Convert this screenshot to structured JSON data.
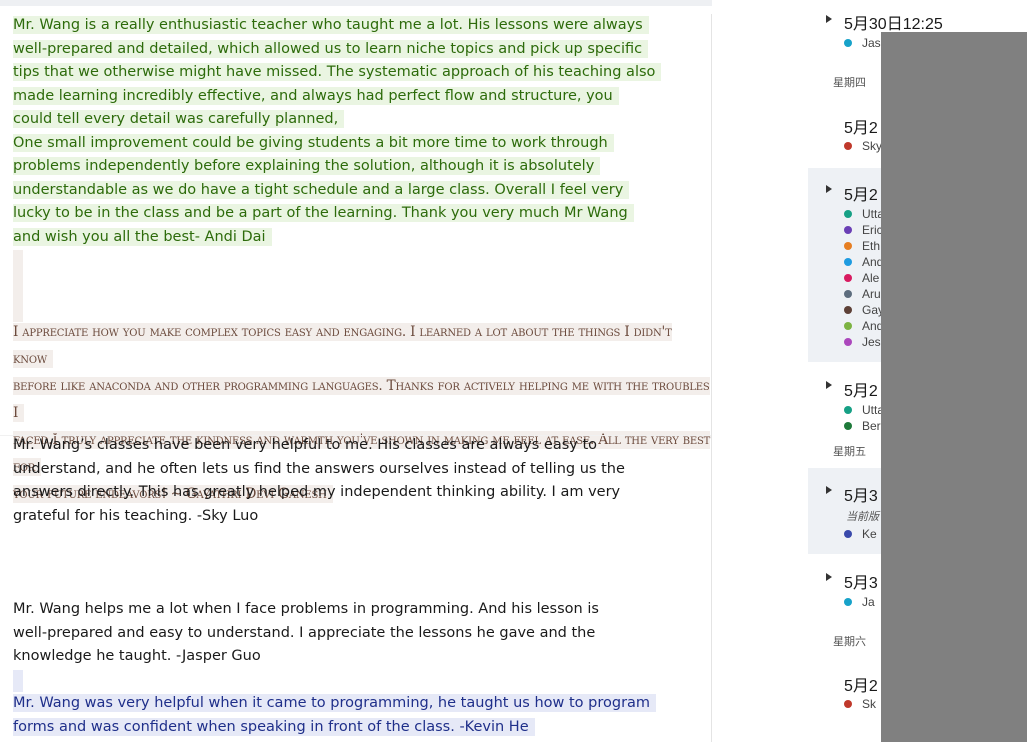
{
  "document": {
    "paragraphs": [
      {
        "style": "green",
        "lines": [
          "Mr. Wang is a really enthusiastic teacher who taught me a lot. His lessons were always",
          "well-prepared and detailed, which allowed us to learn niche topics and pick up specific",
          "tips that we otherwise might have missed. The systematic approach of his teaching also",
          "made learning incredibly effective, and always had perfect flow and structure, you",
          "could tell every detail was carefully planned,",
          "One small improvement could be giving students a bit more time to work through",
          "problems independently before explaining the solution, although it is absolutely",
          "understandable as we do have a tight schedule and a large class. Overall I feel very",
          "lucky to be in the class and be a part of the learning. Thank you very much Mr Wang",
          "and wish you all the best- Andi Dai"
        ]
      },
      {
        "style": "brown",
        "lines": [
          "I appreciate how you make complex topics easy and engaging. I learned a lot about the things I didn't know",
          "before like anaconda and other programming languages. Thanks for actively helping me with the troubles I",
          "faced.I truly appreciate the kindness and warmth you've shown in making me feel at ease. All the very best for",
          "your future endeavors! ~ Gayathri Devi Ganesh"
        ]
      },
      {
        "style": "plain",
        "lines": [
          "Mr. Wang’s classes have been very helpful to me. His classes are always easy to",
          "understand, and he often lets us find the answers ourselves instead of telling us the",
          "answers directly. This has greatly helped my independent thinking ability. I am very",
          "grateful for his teaching. -Sky Luo"
        ]
      },
      {
        "style": "plain",
        "lines": [
          "Mr. Wang helps me a lot when I face problems in programming. And his lesson is",
          "well-prepared and easy to understand. I appreciate the lessons he gave and the",
          "knowledge he taught. -Jasper Guo"
        ]
      },
      {
        "style": "blue",
        "lines": [
          "Mr. Wang was very helpful when it came to programming, he taught us how to program",
          "forms and was confident when speaking in front of the class. -Kevin He"
        ]
      }
    ]
  },
  "sidebar": {
    "g0": {
      "title": "5月30日12:25",
      "authors": [
        {
          "name": "Jas",
          "color": "#17a2c9"
        }
      ]
    },
    "day_thu": "星期四",
    "g1": {
      "title": "5月2",
      "authors": [
        {
          "name": "Sky",
          "color": "#c0392b"
        }
      ]
    },
    "g2": {
      "title": "5月2",
      "authors": [
        {
          "name": "Utta",
          "color": "#16a085"
        },
        {
          "name": "Eric",
          "color": "#6a3fb5"
        },
        {
          "name": "Eth",
          "color": "#e67e22"
        },
        {
          "name": "And",
          "color": "#1e9be0"
        },
        {
          "name": "Ale",
          "color": "#d81b60"
        },
        {
          "name": "Aru",
          "color": "#5d6d7e"
        },
        {
          "name": "Gay",
          "color": "#5d4037"
        },
        {
          "name": "And",
          "color": "#7cb342"
        },
        {
          "name": "Jes",
          "color": "#ab47bc"
        }
      ]
    },
    "g3": {
      "title": "5月2",
      "authors": [
        {
          "name": "Utta",
          "color": "#16a085"
        },
        {
          "name": "Ber",
          "color": "#1e7a3a"
        }
      ]
    },
    "day_fri": "星期五",
    "g4": {
      "title": "5月3",
      "subtitle": "当前版",
      "authors": [
        {
          "name": "Ke",
          "color": "#3949ab"
        }
      ]
    },
    "g5": {
      "title": "5月3",
      "authors": [
        {
          "name": "Ja",
          "color": "#17a2c9"
        }
      ]
    },
    "day_sat": "星期六",
    "g6": {
      "title": "5月2",
      "authors": [
        {
          "name": "Sk",
          "color": "#c0392b"
        }
      ]
    }
  }
}
